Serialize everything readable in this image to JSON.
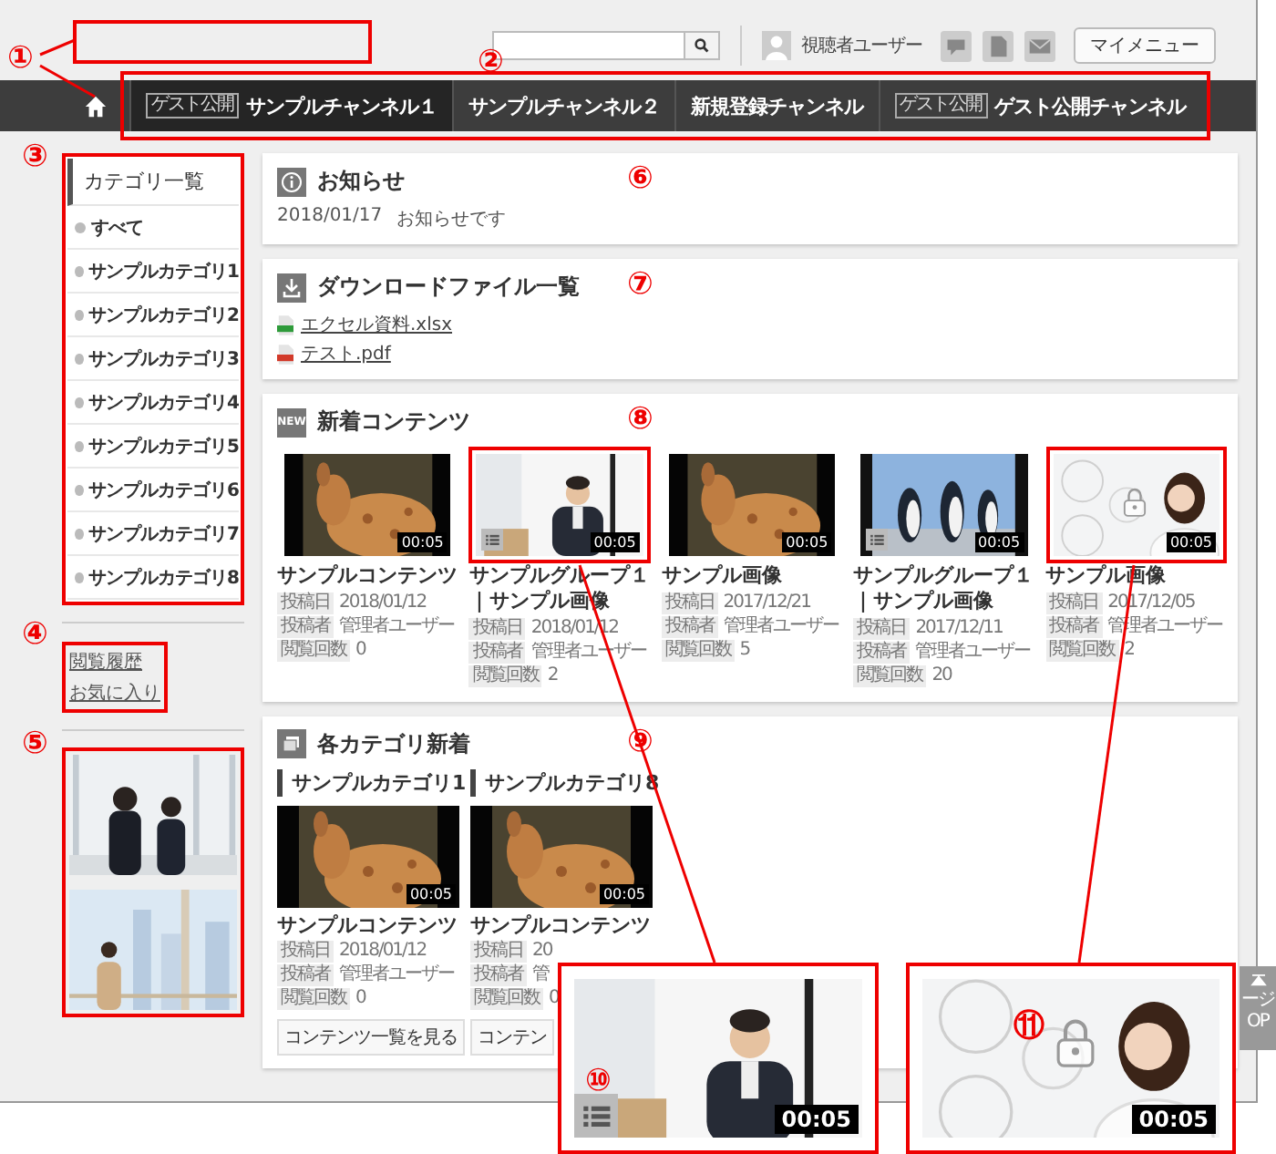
{
  "header": {
    "marker": "①",
    "user_name": "視聴者ユーザー",
    "menu_button": "マイメニュー"
  },
  "nav": {
    "marker": "②",
    "tabs": [
      {
        "label": "サンプルチャンネル１",
        "badge": "ゲスト公開",
        "selected": true
      },
      {
        "label": "サンプルチャンネル２",
        "selected": false
      },
      {
        "label": "新規登録チャンネル",
        "selected": false
      },
      {
        "label": "ゲスト公開チャンネル",
        "badge": "ゲスト公開",
        "selected": false
      }
    ]
  },
  "sidebar": {
    "marker": "③",
    "title": "カテゴリ一覧",
    "items": [
      "すべて",
      "サンプルカテゴリ1",
      "サンプルカテゴリ2",
      "サンプルカテゴリ3",
      "サンプルカテゴリ4",
      "サンプルカテゴリ5",
      "サンプルカテゴリ6",
      "サンプルカテゴリ7",
      "サンプルカテゴリ8"
    ]
  },
  "links": {
    "marker": "④",
    "items": [
      "閲覧履歴",
      "お気に入り"
    ]
  },
  "banners": {
    "marker": "⑤"
  },
  "notice": {
    "marker": "⑥",
    "title": "お知らせ",
    "items": [
      {
        "date": "2018/01/17",
        "text": "お知らせです"
      }
    ]
  },
  "downloads": {
    "marker": "⑦",
    "title": "ダウンロードファイル一覧",
    "files": [
      {
        "name": "エクセル資料.xlsx",
        "color": "#2e9b3a"
      },
      {
        "name": "テスト.pdf",
        "color": "#d23a2a"
      }
    ]
  },
  "new_contents": {
    "marker": "⑧",
    "badge": "NEW",
    "title": "新着コンテンツ",
    "items": [
      {
        "title": "サンプルコンテンツ",
        "duration": "00:05",
        "playlist": false,
        "locked": false,
        "annotated": false,
        "meta": [
          {
            "label": "投稿日",
            "value": "2018/01/12"
          },
          {
            "label": "投稿者",
            "value": "管理者ユーザー"
          },
          {
            "label": "閲覧回数",
            "value": "0"
          }
        ]
      },
      {
        "title": "サンプルグループ１｜サンプル画像",
        "duration": "00:05",
        "playlist": true,
        "locked": false,
        "annotated": true,
        "meta": [
          {
            "label": "投稿日",
            "value": "2018/01/12"
          },
          {
            "label": "投稿者",
            "value": "管理者ユーザー"
          },
          {
            "label": "閲覧回数",
            "value": "2"
          }
        ]
      },
      {
        "title": "サンプル画像",
        "duration": "00:05",
        "playlist": false,
        "locked": false,
        "annotated": false,
        "meta": [
          {
            "label": "投稿日",
            "value": "2017/12/21"
          },
          {
            "label": "投稿者",
            "value": "管理者ユーザー"
          },
          {
            "label": "閲覧回数",
            "value": "5"
          }
        ]
      },
      {
        "title": "サンプルグループ１｜サンプル画像",
        "duration": "00:05",
        "playlist": true,
        "locked": false,
        "annotated": false,
        "meta": [
          {
            "label": "投稿日",
            "value": "2017/12/11"
          },
          {
            "label": "投稿者",
            "value": "管理者ユーザー"
          },
          {
            "label": "閲覧回数",
            "value": "20"
          }
        ]
      },
      {
        "title": "サンプル画像",
        "duration": "00:05",
        "playlist": false,
        "locked": true,
        "annotated": true,
        "meta": [
          {
            "label": "投稿日",
            "value": "2017/12/05"
          },
          {
            "label": "投稿者",
            "value": "管理者ユーザー"
          },
          {
            "label": "閲覧回数",
            "value": "2"
          }
        ]
      }
    ]
  },
  "category_new": {
    "marker": "⑨",
    "title": "各カテゴリ新着",
    "columns": [
      {
        "category": "サンプルカテゴリ1",
        "title": "サンプルコンテンツ",
        "duration": "00:05",
        "meta": [
          {
            "label": "投稿日",
            "value": "2018/01/12"
          },
          {
            "label": "投稿者",
            "value": "管理者ユーザー"
          },
          {
            "label": "閲覧回数",
            "value": "0"
          }
        ],
        "button": "コンテンツ一覧を見る"
      },
      {
        "category": "サンプルカテゴリ8",
        "title": "サンプルコンテンツ",
        "duration": "00:05",
        "meta": [
          {
            "label": "投稿日",
            "value": "20"
          },
          {
            "label": "投稿者",
            "value": "管"
          },
          {
            "label": "閲覧回数",
            "value": "0"
          }
        ],
        "button": "コンテン"
      }
    ]
  },
  "zoom_insets": [
    {
      "marker": "⑩",
      "duration": "00:05",
      "playlist": true,
      "locked": false
    },
    {
      "marker": "⑪",
      "duration": "00:05",
      "playlist": false,
      "locked": true
    }
  ],
  "page_top": {
    "lines": [
      "ージ",
      "OP"
    ]
  }
}
